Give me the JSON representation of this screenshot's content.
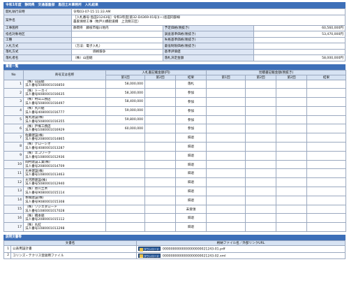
{
  "header": {
    "title": "令和1年度　静岡県　交通基盤部　島田土木事務所　入札結果"
  },
  "info": {
    "open_date_label": "開札執行日時",
    "open_date": "令和03-07-15 11:33 AM",
    "project_name_label": "案件名",
    "project_name_line1": "［入札番号:島田21243号］令和3年度[第32-D4369-01号](一)島田同部線",
    "project_name_line2": "農家保修工事（牧戸川橋街道橋　上流側工区）",
    "site_label": "工事箇所",
    "site_value": "静岡県　藤枝市稲川地内",
    "planned_price_label": "予定価格(税抜き)",
    "planned_price": "60,560,000円",
    "region_label": "指名対象地区",
    "survey_price_label": "調査基準価格(税抜き)",
    "survey_price": "53,470,000円",
    "type_label": "工種",
    "loss_price_label": "失格基準価格(税抜き)",
    "loss_price": "",
    "method_label": "入札方式",
    "method_value": "（方法：電子入札）",
    "min_price_label": "最低制限価格(税抜き)",
    "min_price": "",
    "winner_method_label": "落札方式",
    "winner_method_value": "価格競争",
    "eval_label": "基準評価値",
    "eval_value": "",
    "winner_label": "落札者名",
    "winner_value": "（株）山田組",
    "winning_amount_label": "落札決定金額",
    "winning_amount": "58,000,000円"
  },
  "bids": {
    "section_title": "業者一覧",
    "headers": {
      "no": "No",
      "name": "商号又は名称",
      "group1": "入札書記載金額(円)",
      "group2": "見積書記載金額(税抜き)",
      "r1": "第1回",
      "r2": "第2回",
      "result": "結果"
    },
    "rows": [
      {
        "no": "1",
        "name": "（株）山田組",
        "corp": "法人番号5080001016850",
        "r1": "58,000,000",
        "r2": "",
        "result": "落札"
      },
      {
        "no": "2",
        "name": "（株）トーカイ",
        "corp": "法人番号6080001016635",
        "r1": "58,300,000",
        "r2": "",
        "result": "参加"
      },
      {
        "no": "3",
        "name": "（株）村山工務店",
        "corp": "法人番号5080001016497",
        "r1": "58,400,000",
        "r2": "",
        "result": "参加"
      },
      {
        "no": "4",
        "name": "（株）丸川組",
        "corp": "法人番号4080001016777",
        "r1": "59,000,000",
        "r2": "",
        "result": "参加"
      },
      {
        "no": "5",
        "name": "角丸建設(株)",
        "corp": "法人番号5080001016355",
        "r1": "59,800,000",
        "r2": "",
        "result": "参加"
      },
      {
        "no": "6",
        "name": "（株）戸塚工務店",
        "corp": "法人番号1080001016929",
        "r1": "60,000,000",
        "r2": "",
        "result": "参加"
      },
      {
        "no": "7",
        "name": "佐藤建設(株)",
        "corp": "法人番号2080001014865",
        "r1": "",
        "r2": "",
        "result": "辞退"
      },
      {
        "no": "8",
        "name": "（株）グローシオ",
        "corp": "法人番号4080001013287",
        "r1": "",
        "r2": "",
        "result": "辞退"
      },
      {
        "no": "9",
        "name": "（株）エコワーク",
        "corp": "法人番号1080001012936",
        "r1": "",
        "r2": "",
        "result": "辞退"
      },
      {
        "no": "10",
        "name": "岡村建設工業(株)",
        "corp": "法人番号2080001014709",
        "r1": "",
        "r2": "",
        "result": "辞退"
      },
      {
        "no": "11",
        "name": "大井建設(株)",
        "corp": "法人番号1080001013463",
        "r1": "",
        "r2": "",
        "result": "辞退"
      },
      {
        "no": "12",
        "name": "大河原建設(株)",
        "corp": "法人番号5080001012940",
        "r1": "",
        "r2": "",
        "result": "辞退"
      },
      {
        "no": "13",
        "name": "（株）原川土木",
        "corp": "法人番号9080001015114",
        "r1": "",
        "r2": "",
        "result": "辞退"
      },
      {
        "no": "14",
        "name": "本橋建設(株)",
        "corp": "法人番号9080001015308",
        "r1": "",
        "r2": "",
        "result": "辞退"
      },
      {
        "no": "15",
        "name": "（株）ワジエダロード",
        "corp": "法人番号1080001017028",
        "r1": "",
        "r2": "",
        "result": "未受領"
      },
      {
        "no": "16",
        "name": "（株）橋本組",
        "corp": "法人番号2080001015112",
        "r1": "",
        "r2": "",
        "result": "辞退"
      },
      {
        "no": "17",
        "name": "（株）丸紅",
        "corp": "法人番号1080001013298",
        "r1": "",
        "r2": "",
        "result": "辞退"
      }
    ]
  },
  "docs": {
    "section_title": "説明文書等",
    "headers": {
      "name": "文書名",
      "file": "格納ファイル名／外部リンクURL"
    },
    "download_label": "ダウンロード",
    "rows": [
      {
        "no": "1",
        "name": "公表用設計書",
        "file": "0000000000000000000021243-01.pdf"
      },
      {
        "no": "2",
        "name": "コリンズ・テクリス登録用ファイル",
        "file": "0000000000000000000021243-02.xml"
      }
    ]
  }
}
